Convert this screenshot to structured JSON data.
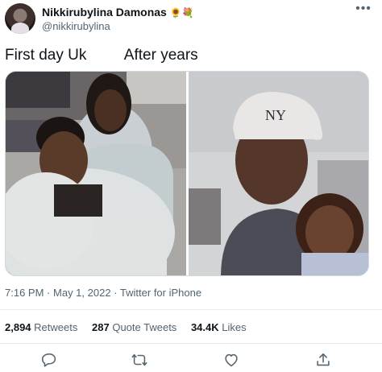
{
  "user": {
    "display_name": "Nikkirubylina Damonas",
    "emojis": "🌻💐",
    "handle": "@nikkirubylina"
  },
  "tweet": {
    "text": "First day Uk         After years"
  },
  "media": {
    "left_photo": "before-photo",
    "right_photo": "after-photo"
  },
  "meta": {
    "time": "7:16 PM",
    "date": "May 1, 2022",
    "separator": "·",
    "source": "Twitter for iPhone"
  },
  "stats": {
    "retweets_count": "2,894",
    "retweets_label": "Retweets",
    "quote_count": "287",
    "quote_label": "Quote Tweets",
    "likes_count": "34.4K",
    "likes_label": "Likes"
  },
  "icons": {
    "reply": "reply-icon",
    "retweet": "retweet-icon",
    "like": "heart-icon",
    "share": "share-icon",
    "more": "more-icon"
  },
  "colors": {
    "text": "#0f1419",
    "secondary": "#536471",
    "divider": "#e6ecf0"
  }
}
